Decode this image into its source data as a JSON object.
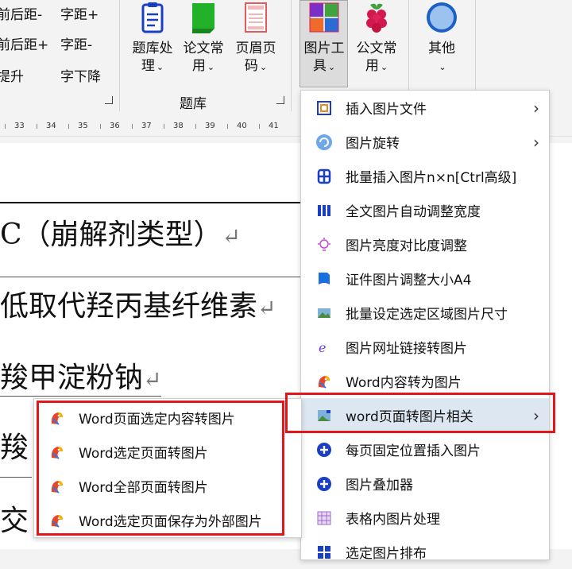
{
  "ribbon": {
    "left_col1": [
      "前后距-",
      "前后距+",
      "提升"
    ],
    "left_col2": [
      "字距+",
      "字距-",
      "字下降"
    ],
    "tiku_btn": {
      "line1": "题库处",
      "line2": "理"
    },
    "lunwen_btn": {
      "line1": "论文常",
      "line2": "用"
    },
    "yemei_btn": {
      "line1": "页眉页",
      "line2": "码"
    },
    "tupian_btn": {
      "line1": "图片工",
      "line2": "具"
    },
    "gongwen_btn": {
      "line1": "公文常",
      "line2": "用"
    },
    "qita_btn": {
      "line1": "其他"
    },
    "group_label": "题库"
  },
  "ruler": {
    "numbers": [
      "33",
      "34",
      "35",
      "36",
      "37",
      "38",
      "39",
      "40",
      "41"
    ]
  },
  "document": {
    "line1": "C（崩解剂类型）",
    "line2": "低取代羟丙基纤维素",
    "line3": "羧甲淀粉钠",
    "line4": "羧",
    "line5": "交",
    "para_mark": "↵"
  },
  "menu": {
    "items": [
      {
        "label": "插入图片文件",
        "icon": "insert-image-icon",
        "arrow": "›"
      },
      {
        "label": "图片旋转",
        "icon": "rotate-icon",
        "arrow": "›"
      },
      {
        "label": "批量插入图片n×n[Ctrl高级]",
        "icon": "grid-insert-icon"
      },
      {
        "label": "全文图片自动调整宽度",
        "icon": "auto-width-icon"
      },
      {
        "label": "图片亮度对比度调整",
        "icon": "brightness-icon"
      },
      {
        "label": "证件图片调整大小A4",
        "icon": "id-photo-icon"
      },
      {
        "label": "批量设定选定区域图片尺寸",
        "icon": "image-size-icon"
      },
      {
        "label": "图片网址链接转图片",
        "icon": "url-image-icon"
      },
      {
        "label": "Word内容转为图片",
        "icon": "parrot-icon"
      },
      {
        "label": "word页面转图片相关",
        "icon": "page-image-icon",
        "arrow": "›"
      },
      {
        "label": "每页固定位置插入图片",
        "icon": "plus-circle-icon"
      },
      {
        "label": "图片叠加器",
        "icon": "plus-circle-icon"
      },
      {
        "label": "表格内图片处理",
        "icon": "table-image-icon"
      },
      {
        "label": "选定图片排布",
        "icon": "windows-icon"
      }
    ]
  },
  "submenu": {
    "items": [
      {
        "label": "Word页面选定内容转图片",
        "icon": "parrot-icon"
      },
      {
        "label": "Word选定页面转图片",
        "icon": "parrot-icon"
      },
      {
        "label": "Word全部页面转图片",
        "icon": "parrot-icon"
      },
      {
        "label": "Word选定页面保存为外部图片",
        "icon": "parrot-icon"
      }
    ]
  },
  "colors": {
    "highlight": "#e3161a",
    "accent": "#1a3fc4"
  }
}
